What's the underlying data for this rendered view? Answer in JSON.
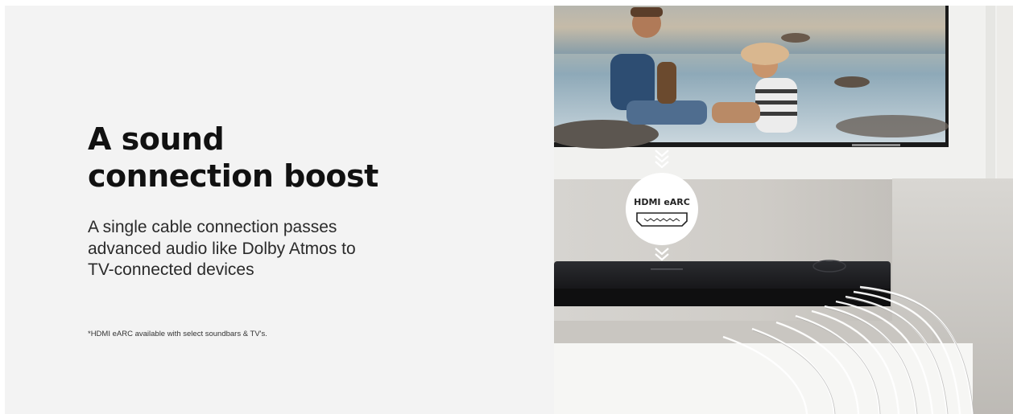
{
  "feature": {
    "headline_lines": [
      "A sound",
      "connection boost"
    ],
    "description_lines": [
      "A single cable connection passes",
      "advanced audio like Dolby Atmos to",
      "TV-connected devices"
    ],
    "footnote": "*HDMI eARC available with select soundbars & TV's."
  },
  "illustration": {
    "badge_label": "HDMI eARC",
    "icons": [
      "hdmi-port-icon",
      "chevron-double-down-icon"
    ]
  },
  "colors": {
    "panel_background": "#f3f3f3",
    "headline": "#111111",
    "body_text": "#2a2a2a",
    "soundbar": "#1b1c1f",
    "wall": "#f1f1ef"
  }
}
